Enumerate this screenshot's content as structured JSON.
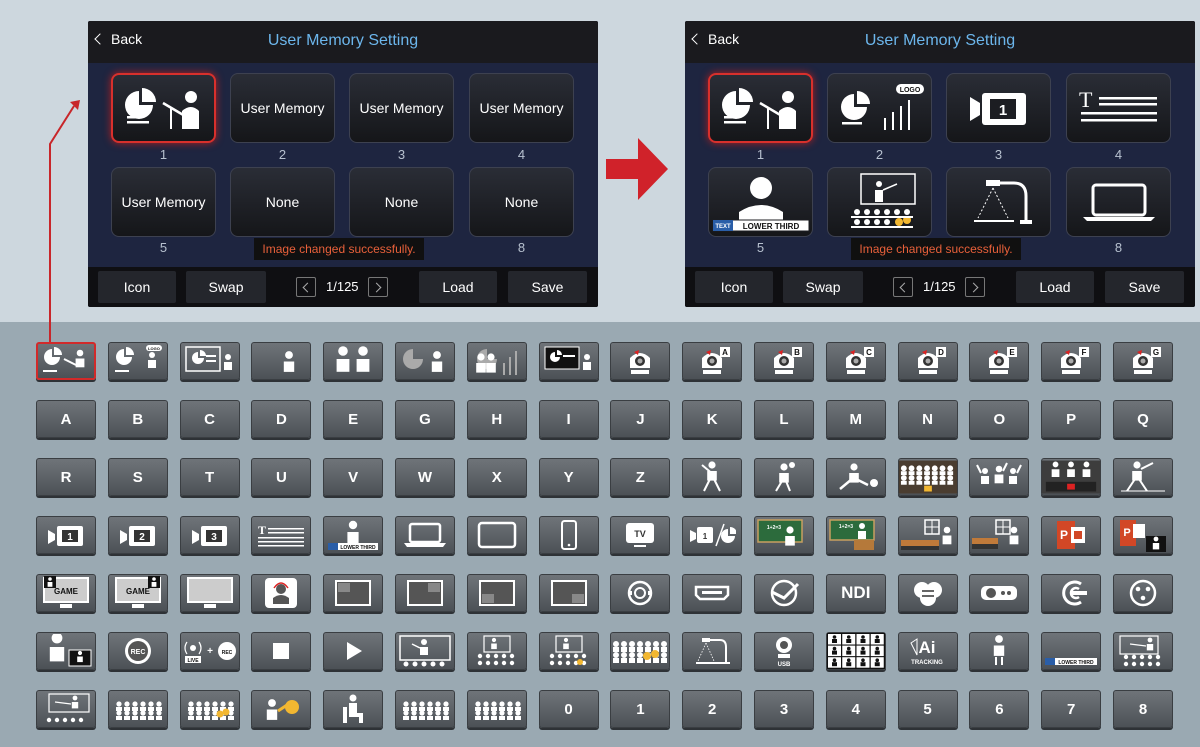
{
  "panels": [
    {
      "back": "Back",
      "title": "User Memory Setting",
      "slots": [
        {
          "num": "1",
          "label": "",
          "icon": "presenter-pie-icon",
          "selected": true
        },
        {
          "num": "2",
          "label": "User Memory"
        },
        {
          "num": "3",
          "label": "User Memory"
        },
        {
          "num": "4",
          "label": "User Memory"
        },
        {
          "num": "5",
          "label": "User Memory"
        },
        {
          "num": "6",
          "label": "None"
        },
        {
          "num": "7",
          "label": "None"
        },
        {
          "num": "8",
          "label": "None"
        }
      ],
      "toast": "Image changed successfully.",
      "icon_btn": "Icon",
      "swap_btn": "Swap",
      "page": "1/125",
      "load_btn": "Load",
      "save_btn": "Save"
    },
    {
      "back": "Back",
      "title": "User Memory Setting",
      "slots": [
        {
          "num": "1",
          "icon": "presenter-pie-icon",
          "selected": true
        },
        {
          "num": "2",
          "icon": "pie-bar-logo-icon",
          "logo": "LOGO"
        },
        {
          "num": "3",
          "icon": "camera-1-icon"
        },
        {
          "num": "4",
          "icon": "text-lines-icon"
        },
        {
          "num": "5",
          "icon": "lower-third-icon",
          "lower": "LOWER THIRD",
          "tag": "TEXT"
        },
        {
          "num": "6",
          "icon": "classroom-icon"
        },
        {
          "num": "7",
          "icon": "document-camera-icon"
        },
        {
          "num": "8",
          "icon": "laptop-icon"
        }
      ],
      "toast": "Image changed successfully.",
      "icon_btn": "Icon",
      "swap_btn": "Swap",
      "page": "1/125",
      "load_btn": "Load",
      "save_btn": "Save"
    }
  ],
  "colors": {
    "accent_red": "#d8302c",
    "title_blue": "#6cb6ec",
    "toast_orange": "#e8603a"
  },
  "icon_grid": [
    [
      "presenter-pie-icon",
      "pie-logo-icon",
      "pie-screen-icon",
      "person-icon",
      "two-people-icon",
      "pie-person-icon",
      "pie-bars-people-icon",
      "screen-person-icon",
      "ptz-camera-icon",
      "ptz-camera-a-icon",
      "ptz-camera-b-icon",
      "ptz-camera-c-icon",
      "ptz-camera-d-icon",
      "ptz-camera-e-icon",
      "ptz-camera-f-icon",
      "ptz-camera-g-icon"
    ],
    [
      "A",
      "B",
      "C",
      "D",
      "E",
      "G",
      "H",
      "I",
      "J",
      "K",
      "L",
      "M",
      "N",
      "O",
      "P",
      "Q"
    ],
    [
      "R",
      "S",
      "T",
      "U",
      "V",
      "W",
      "X",
      "Y",
      "Z",
      "baseball-icon",
      "basketball-icon",
      "soccer-icon",
      "audience-icon",
      "cheer-icon",
      "concert-icon",
      "tennis-icon"
    ],
    [
      "camera-1-icon",
      "camera-2-icon",
      "camera-3-icon",
      "text-lines-icon",
      "lower-third-icon",
      "laptop-icon",
      "tablet-icon",
      "phone-icon",
      "tv-icon",
      "camera-pie-icon",
      "chalkboard-person-icon",
      "chalkboard-desk-icon",
      "desk-window-icon",
      "desk-window2-icon",
      "powerpoint-icon",
      "powerpoint-person-icon"
    ],
    [
      "monitor-game-icon",
      "monitor-game2-icon",
      "monitor-icon",
      "headset-icon",
      "pip-1-icon",
      "pip-2-icon",
      "pip-3-icon",
      "pip-4-icon",
      "sdi-icon",
      "hdmi-icon",
      "hdbaset-icon",
      "NDI",
      "cloud-icon",
      "projector-icon",
      "usb-c-icon",
      "xlr-icon"
    ],
    [
      "presenter-video-icon",
      "rec-icon",
      "live-rec-icon",
      "stop-icon",
      "play-icon",
      "classroom-screen-icon",
      "classroom-small-icon",
      "classroom-small2-icon",
      "audience-orange-icon",
      "document-camera-icon",
      "usb-camera-icon",
      "multiview-icon",
      "ai-tracking-icon",
      "standing-person-icon",
      "lower-third-bar-icon",
      "classroom-board-icon"
    ],
    [
      "teacher-board-icon",
      "audience-rows-icon",
      "audience-rows-orange-icon",
      "raise-hand-icon",
      "sitting-person-icon",
      "audience-rows2-icon",
      "audience-rows3-icon",
      "0",
      "1",
      "2",
      "3",
      "4",
      "5",
      "6",
      "7",
      "8"
    ]
  ],
  "grid_text": {
    "ai": "Ai",
    "ai_sub": "TRACKING",
    "rec": "REC",
    "live": "LIVE",
    "usb": "USB",
    "logo": "LOGO",
    "lower": "LOWER THIRD",
    "tv": "TV",
    "game": "GAME",
    "ndi": "NDI",
    "abc": "1+2=3",
    "abc2": "1+2=3",
    "tags": [
      "A",
      "B",
      "C",
      "D",
      "E",
      "F",
      "G"
    ],
    "cams": [
      "1",
      "2",
      "3"
    ]
  }
}
